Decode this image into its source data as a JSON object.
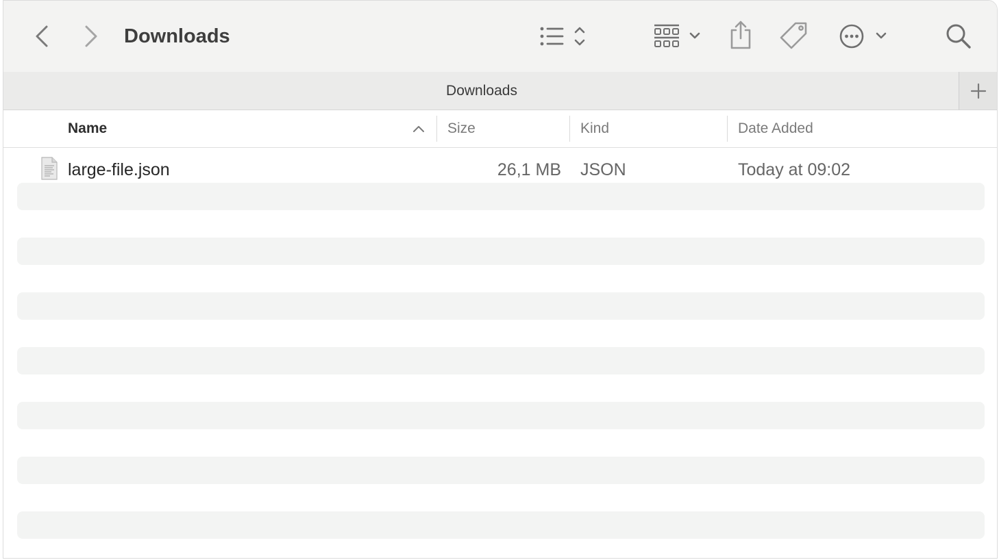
{
  "window": {
    "title": "Downloads"
  },
  "toolbar": {
    "back_icon": "chevron-left-icon",
    "forward_icon": "chevron-right-icon",
    "view_list_icon": "list-view-icon",
    "group_icon": "grid-group-icon",
    "share_icon": "share-icon",
    "tag_icon": "tag-icon",
    "more_icon": "ellipsis-circle-icon",
    "search_icon": "search-icon"
  },
  "tabbar": {
    "active_tab": "Downloads",
    "new_tab_icon": "plus-icon"
  },
  "columns": {
    "name": "Name",
    "size": "Size",
    "kind": "Kind",
    "date_added": "Date Added",
    "sort_direction": "ascending"
  },
  "files": [
    {
      "name": "large-file.json",
      "size": "26,1 MB",
      "kind": "JSON",
      "date_added": "Today at 09:02",
      "icon": "document-icon"
    }
  ],
  "colors": {
    "toolbar_bg": "#f3f3f2",
    "stripe": "#f3f4f3",
    "title": "#3e3e3e"
  }
}
